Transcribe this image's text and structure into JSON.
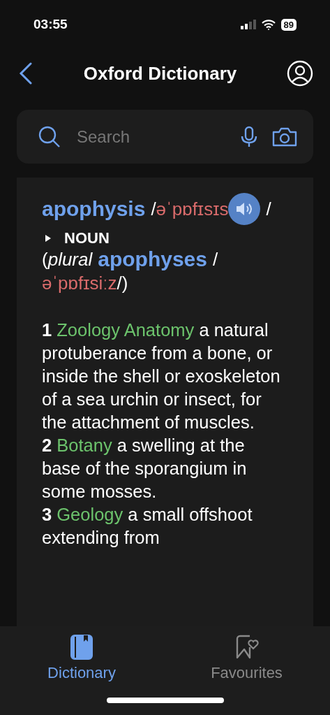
{
  "status_bar": {
    "time": "03:55",
    "battery": "89"
  },
  "nav": {
    "title": "Oxford Dictionary"
  },
  "search": {
    "placeholder": "Search"
  },
  "entry": {
    "headline": [
      {
        "kind": "headword",
        "text": "apophysis"
      },
      {
        "kind": "plain",
        "text": "/"
      },
      {
        "kind": "pron",
        "text": "əˈpɒfɪsɪs"
      },
      {
        "kind": "audio"
      },
      {
        "kind": "plain",
        "text": "/"
      }
    ],
    "part_of_speech": "NOUN",
    "forms": [
      {
        "kind": "plain",
        "text": "("
      },
      {
        "kind": "label",
        "text": "plural"
      },
      {
        "kind": "headword",
        "text": "apophyses"
      },
      {
        "kind": "plain",
        "text": "/"
      },
      {
        "kind": "pron",
        "text": "əˈpɒfɪsiːz"
      },
      {
        "kind": "plain",
        "text": "/)"
      }
    ],
    "senses": [
      {
        "number": "1",
        "domain": "Zoology Anatomy",
        "text": "a natural protuberance from a bone, or inside the shell or exoskeleton of a sea urchin or insect, for the attachment of muscles."
      },
      {
        "number": "2",
        "domain": "Botany",
        "text": "a swelling at the base of the sporangium in some mosses."
      },
      {
        "number": "3",
        "domain": "Geology",
        "text": "a small offshoot extending from"
      }
    ]
  },
  "tabs": [
    {
      "label": "Dictionary",
      "selected": true
    },
    {
      "label": "Favourites",
      "selected": false
    }
  ]
}
